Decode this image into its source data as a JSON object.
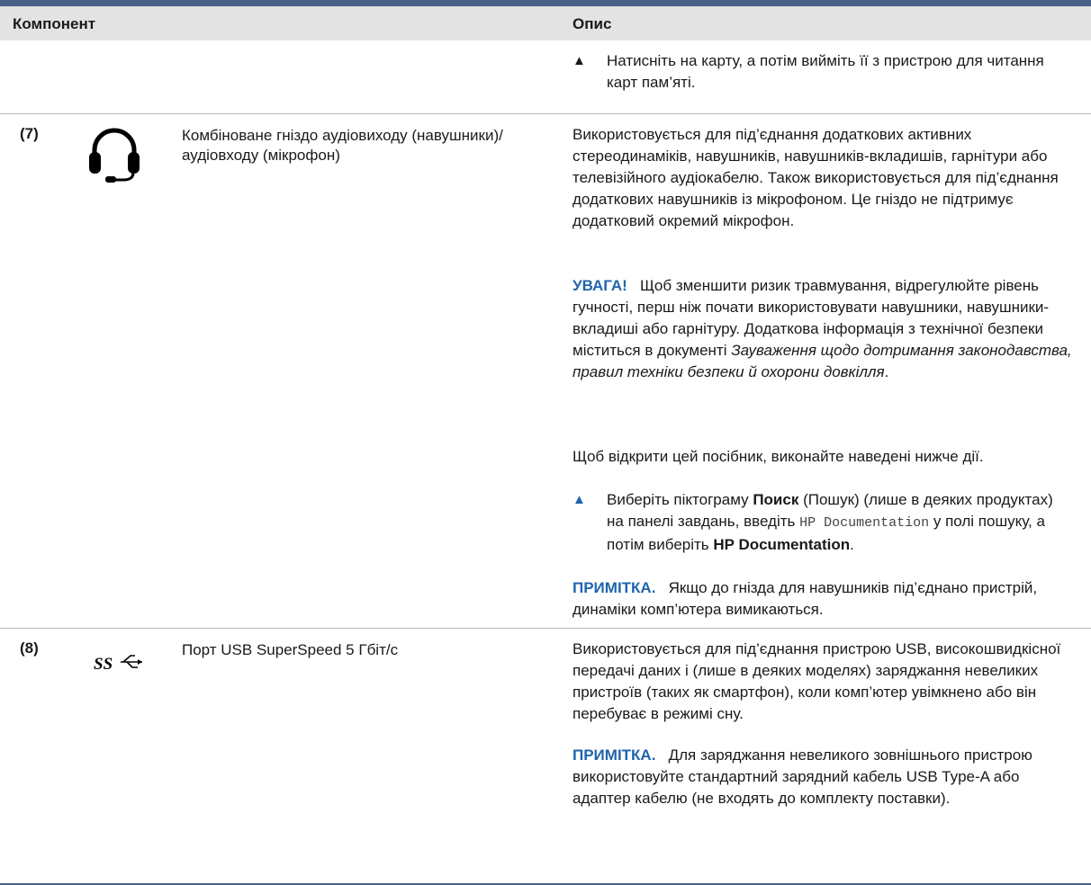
{
  "header": {
    "col_component": "Компонент",
    "col_description": "Опис"
  },
  "row_top": {
    "bullet": "▲",
    "text": "Натисніть на карту, а потім вийміть її з пристрою для читання карт пам’яті."
  },
  "row7": {
    "number": "(7)",
    "icon": "headset-icon",
    "name": "Комбіноване гніздо аудіовиходу (навушники)/аудіовходу (мікрофон)",
    "desc1": "Використовується для під’єднання додаткових активних стереодинаміків, навушників, навушників-вкладишів, гарнітури або телевізійного аудіокабелю. Також використовується для під’єднання додаткових навушників із мікрофоном. Це гніздо не підтримує додатковий окремий мікрофон.",
    "warning_label": "УВАГА!",
    "warning_text": "Щоб зменшити ризик травмування, відрегулюйте рівень гучності, перш ніж почати використовувати навушники, навушники-вкладиші або гарнітуру. Додаткова інформація з технічної безпеки міститься в документі",
    "warning_doc": "Зауваження щодо дотримання законодавства, правил техніки безпеки й охорони довкілля",
    "warning_end": ".",
    "open_guide": "Щоб відкрити цей посібник, виконайте наведені нижче дії.",
    "step_bullet": "▲",
    "step_a": "Виберіть піктограму",
    "step_search": "Поиск",
    "step_b": "(Пошук) (лише в деяких продуктах) на панелі завдань, введіть",
    "step_code": "HP Documentation",
    "step_c": "у полі пошуку, а потім виберіть",
    "step_target": "HP Documentation",
    "step_end": ".",
    "note_label": "ПРИМІТКА.",
    "note_text": "Якщо до гнізда для навушників під’єднано пристрій, динаміки комп’ютера вимикаються."
  },
  "row8": {
    "number": "(8)",
    "icon": "usb-superspeed-icon",
    "name": "Порт USB SuperSpeed 5 Гбіт/с",
    "desc1": "Використовується для під’єднання пристрою USB, високошвидкісної передачі даних і (лише в деяких моделях) заряджання невеликих пристроїв (таких як смартфон), коли комп’ютер увімкнено або він перебуває в режимі сну.",
    "note_label": "ПРИМІТКА.",
    "note_text": "Для заряджання невеликого зовнішнього пристрою використовуйте стандартний зарядний кабель USB Type-A або адаптер кабелю (не входять до комплекту поставки)."
  },
  "colors": {
    "accent": "#1f64ad",
    "rule": "#4a5f86",
    "header_bg": "#e3e3e3"
  }
}
